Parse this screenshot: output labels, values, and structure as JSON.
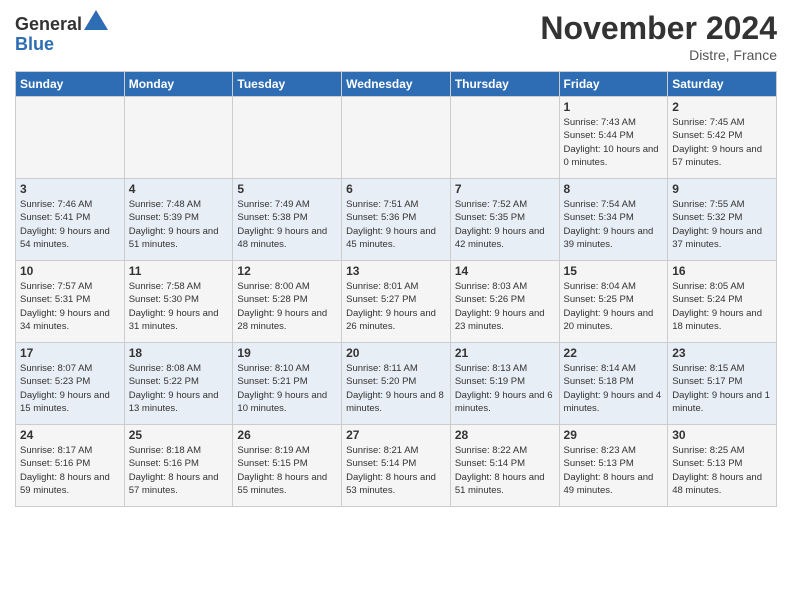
{
  "header": {
    "logo_general": "General",
    "logo_blue": "Blue",
    "month_title": "November 2024",
    "location": "Distre, France"
  },
  "days_of_week": [
    "Sunday",
    "Monday",
    "Tuesday",
    "Wednesday",
    "Thursday",
    "Friday",
    "Saturday"
  ],
  "weeks": [
    [
      {
        "day": "",
        "info": ""
      },
      {
        "day": "",
        "info": ""
      },
      {
        "day": "",
        "info": ""
      },
      {
        "day": "",
        "info": ""
      },
      {
        "day": "",
        "info": ""
      },
      {
        "day": "1",
        "info": "Sunrise: 7:43 AM\nSunset: 5:44 PM\nDaylight: 10 hours and 0 minutes."
      },
      {
        "day": "2",
        "info": "Sunrise: 7:45 AM\nSunset: 5:42 PM\nDaylight: 9 hours and 57 minutes."
      }
    ],
    [
      {
        "day": "3",
        "info": "Sunrise: 7:46 AM\nSunset: 5:41 PM\nDaylight: 9 hours and 54 minutes."
      },
      {
        "day": "4",
        "info": "Sunrise: 7:48 AM\nSunset: 5:39 PM\nDaylight: 9 hours and 51 minutes."
      },
      {
        "day": "5",
        "info": "Sunrise: 7:49 AM\nSunset: 5:38 PM\nDaylight: 9 hours and 48 minutes."
      },
      {
        "day": "6",
        "info": "Sunrise: 7:51 AM\nSunset: 5:36 PM\nDaylight: 9 hours and 45 minutes."
      },
      {
        "day": "7",
        "info": "Sunrise: 7:52 AM\nSunset: 5:35 PM\nDaylight: 9 hours and 42 minutes."
      },
      {
        "day": "8",
        "info": "Sunrise: 7:54 AM\nSunset: 5:34 PM\nDaylight: 9 hours and 39 minutes."
      },
      {
        "day": "9",
        "info": "Sunrise: 7:55 AM\nSunset: 5:32 PM\nDaylight: 9 hours and 37 minutes."
      }
    ],
    [
      {
        "day": "10",
        "info": "Sunrise: 7:57 AM\nSunset: 5:31 PM\nDaylight: 9 hours and 34 minutes."
      },
      {
        "day": "11",
        "info": "Sunrise: 7:58 AM\nSunset: 5:30 PM\nDaylight: 9 hours and 31 minutes."
      },
      {
        "day": "12",
        "info": "Sunrise: 8:00 AM\nSunset: 5:28 PM\nDaylight: 9 hours and 28 minutes."
      },
      {
        "day": "13",
        "info": "Sunrise: 8:01 AM\nSunset: 5:27 PM\nDaylight: 9 hours and 26 minutes."
      },
      {
        "day": "14",
        "info": "Sunrise: 8:03 AM\nSunset: 5:26 PM\nDaylight: 9 hours and 23 minutes."
      },
      {
        "day": "15",
        "info": "Sunrise: 8:04 AM\nSunset: 5:25 PM\nDaylight: 9 hours and 20 minutes."
      },
      {
        "day": "16",
        "info": "Sunrise: 8:05 AM\nSunset: 5:24 PM\nDaylight: 9 hours and 18 minutes."
      }
    ],
    [
      {
        "day": "17",
        "info": "Sunrise: 8:07 AM\nSunset: 5:23 PM\nDaylight: 9 hours and 15 minutes."
      },
      {
        "day": "18",
        "info": "Sunrise: 8:08 AM\nSunset: 5:22 PM\nDaylight: 9 hours and 13 minutes."
      },
      {
        "day": "19",
        "info": "Sunrise: 8:10 AM\nSunset: 5:21 PM\nDaylight: 9 hours and 10 minutes."
      },
      {
        "day": "20",
        "info": "Sunrise: 8:11 AM\nSunset: 5:20 PM\nDaylight: 9 hours and 8 minutes."
      },
      {
        "day": "21",
        "info": "Sunrise: 8:13 AM\nSunset: 5:19 PM\nDaylight: 9 hours and 6 minutes."
      },
      {
        "day": "22",
        "info": "Sunrise: 8:14 AM\nSunset: 5:18 PM\nDaylight: 9 hours and 4 minutes."
      },
      {
        "day": "23",
        "info": "Sunrise: 8:15 AM\nSunset: 5:17 PM\nDaylight: 9 hours and 1 minute."
      }
    ],
    [
      {
        "day": "24",
        "info": "Sunrise: 8:17 AM\nSunset: 5:16 PM\nDaylight: 8 hours and 59 minutes."
      },
      {
        "day": "25",
        "info": "Sunrise: 8:18 AM\nSunset: 5:16 PM\nDaylight: 8 hours and 57 minutes."
      },
      {
        "day": "26",
        "info": "Sunrise: 8:19 AM\nSunset: 5:15 PM\nDaylight: 8 hours and 55 minutes."
      },
      {
        "day": "27",
        "info": "Sunrise: 8:21 AM\nSunset: 5:14 PM\nDaylight: 8 hours and 53 minutes."
      },
      {
        "day": "28",
        "info": "Sunrise: 8:22 AM\nSunset: 5:14 PM\nDaylight: 8 hours and 51 minutes."
      },
      {
        "day": "29",
        "info": "Sunrise: 8:23 AM\nSunset: 5:13 PM\nDaylight: 8 hours and 49 minutes."
      },
      {
        "day": "30",
        "info": "Sunrise: 8:25 AM\nSunset: 5:13 PM\nDaylight: 8 hours and 48 minutes."
      }
    ]
  ]
}
